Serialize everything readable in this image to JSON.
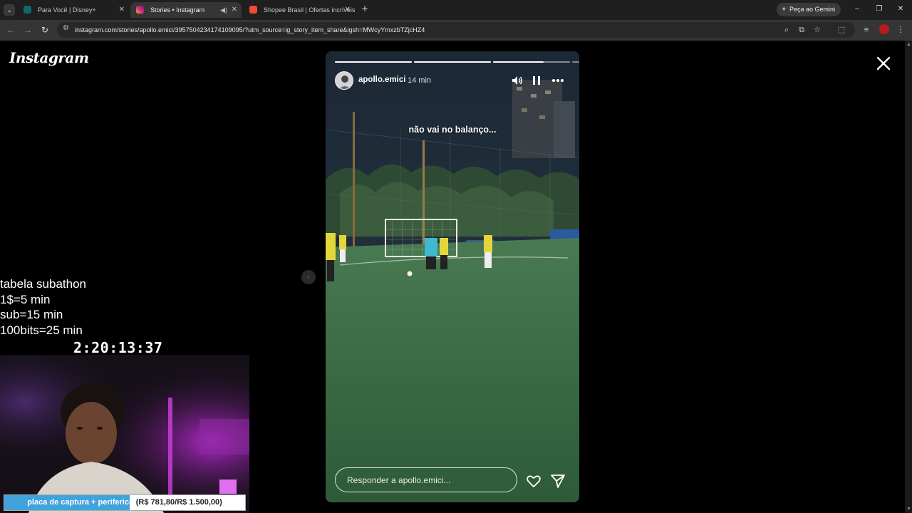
{
  "browser": {
    "tabs": [
      {
        "title": "Para Você | Disney+",
        "active": false
      },
      {
        "title": "Stories • Instagram",
        "active": true
      },
      {
        "title": "Shopee Brasil | Ofertas incríveis",
        "active": false
      }
    ],
    "gemini_label": "Peça ao Gemini",
    "url": "instagram.com/stories/apollo.emici/3957504234174109095/?utm_source=ig_story_item_share&igsh=MWcyYmxzbTZjcHZ4"
  },
  "instagram": {
    "logo": "Instagram",
    "story": {
      "username": "apollo.emici",
      "time": "14 min",
      "caption": "não vai no balanço...",
      "progress": [
        1.0,
        1.0,
        0.66,
        0.0
      ],
      "reply_placeholder": "Responder a apollo.emici..."
    }
  },
  "overlay": {
    "subathon_lines": [
      "tabela subathon",
      "1$=5 min",
      "sub=15 min",
      "100bits=25 min"
    ],
    "timer": "2:20:13:37",
    "goal": {
      "label_filled": "placa de captura + periferico",
      "label_rest": " (R$ 781,80/R$ 1.500,00)",
      "current": 781.8,
      "target": 1500.0
    }
  },
  "colors": {
    "goal_fill": "#41a3dc",
    "instagram_favicon": "#d62976",
    "shopee_favicon": "#ee4d2d",
    "disney_favicon": "#0f6b6b"
  }
}
